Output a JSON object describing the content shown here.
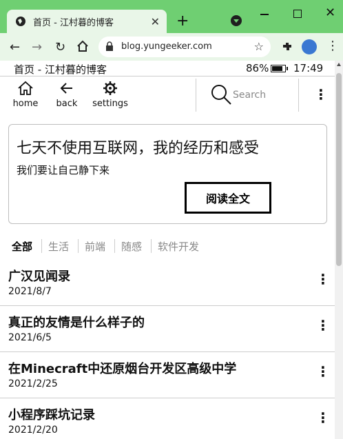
{
  "browser": {
    "tab_title": "首页 - 江村暮的博客",
    "url": "blog.yungeeker.com",
    "new_tab": "+",
    "close_tab": "✕",
    "icons": [
      "globe-icon",
      "close-icon",
      "plus-icon",
      "tab-search-icon",
      "minimize-icon",
      "maximize-icon",
      "window-close-icon",
      "back-icon",
      "forward-icon",
      "reload-icon",
      "home-icon",
      "lock-icon",
      "star-icon",
      "extensions-icon",
      "profile-icon",
      "menu-icon"
    ]
  },
  "status": {
    "page_title": "首页 - 江村暮的博客",
    "battery": "86%",
    "time": "17:49"
  },
  "appbar": {
    "home": "home",
    "back": "back",
    "settings": "settings",
    "search_placeholder": "Search"
  },
  "hero": {
    "title": "七天不使用互联网，我的经历和感受",
    "subtitle": "我们要让自己静下来",
    "button": "阅读全文"
  },
  "categories": [
    "全部",
    "生活",
    "前端",
    "随感",
    "软件开发"
  ],
  "posts": [
    {
      "title": "广汉见闻录",
      "date": "2021/8/7"
    },
    {
      "title": "真正的友情是什么样子的",
      "date": "2021/6/5"
    },
    {
      "title": "在Minecraft中还原烟台开发区高级中学",
      "date": "2021/2/25"
    },
    {
      "title": "小程序踩坑记录",
      "date": "2021/2/20"
    }
  ],
  "colors": {
    "browser_frame": "#6fcf72",
    "toolbar": "#e9f6e8"
  }
}
